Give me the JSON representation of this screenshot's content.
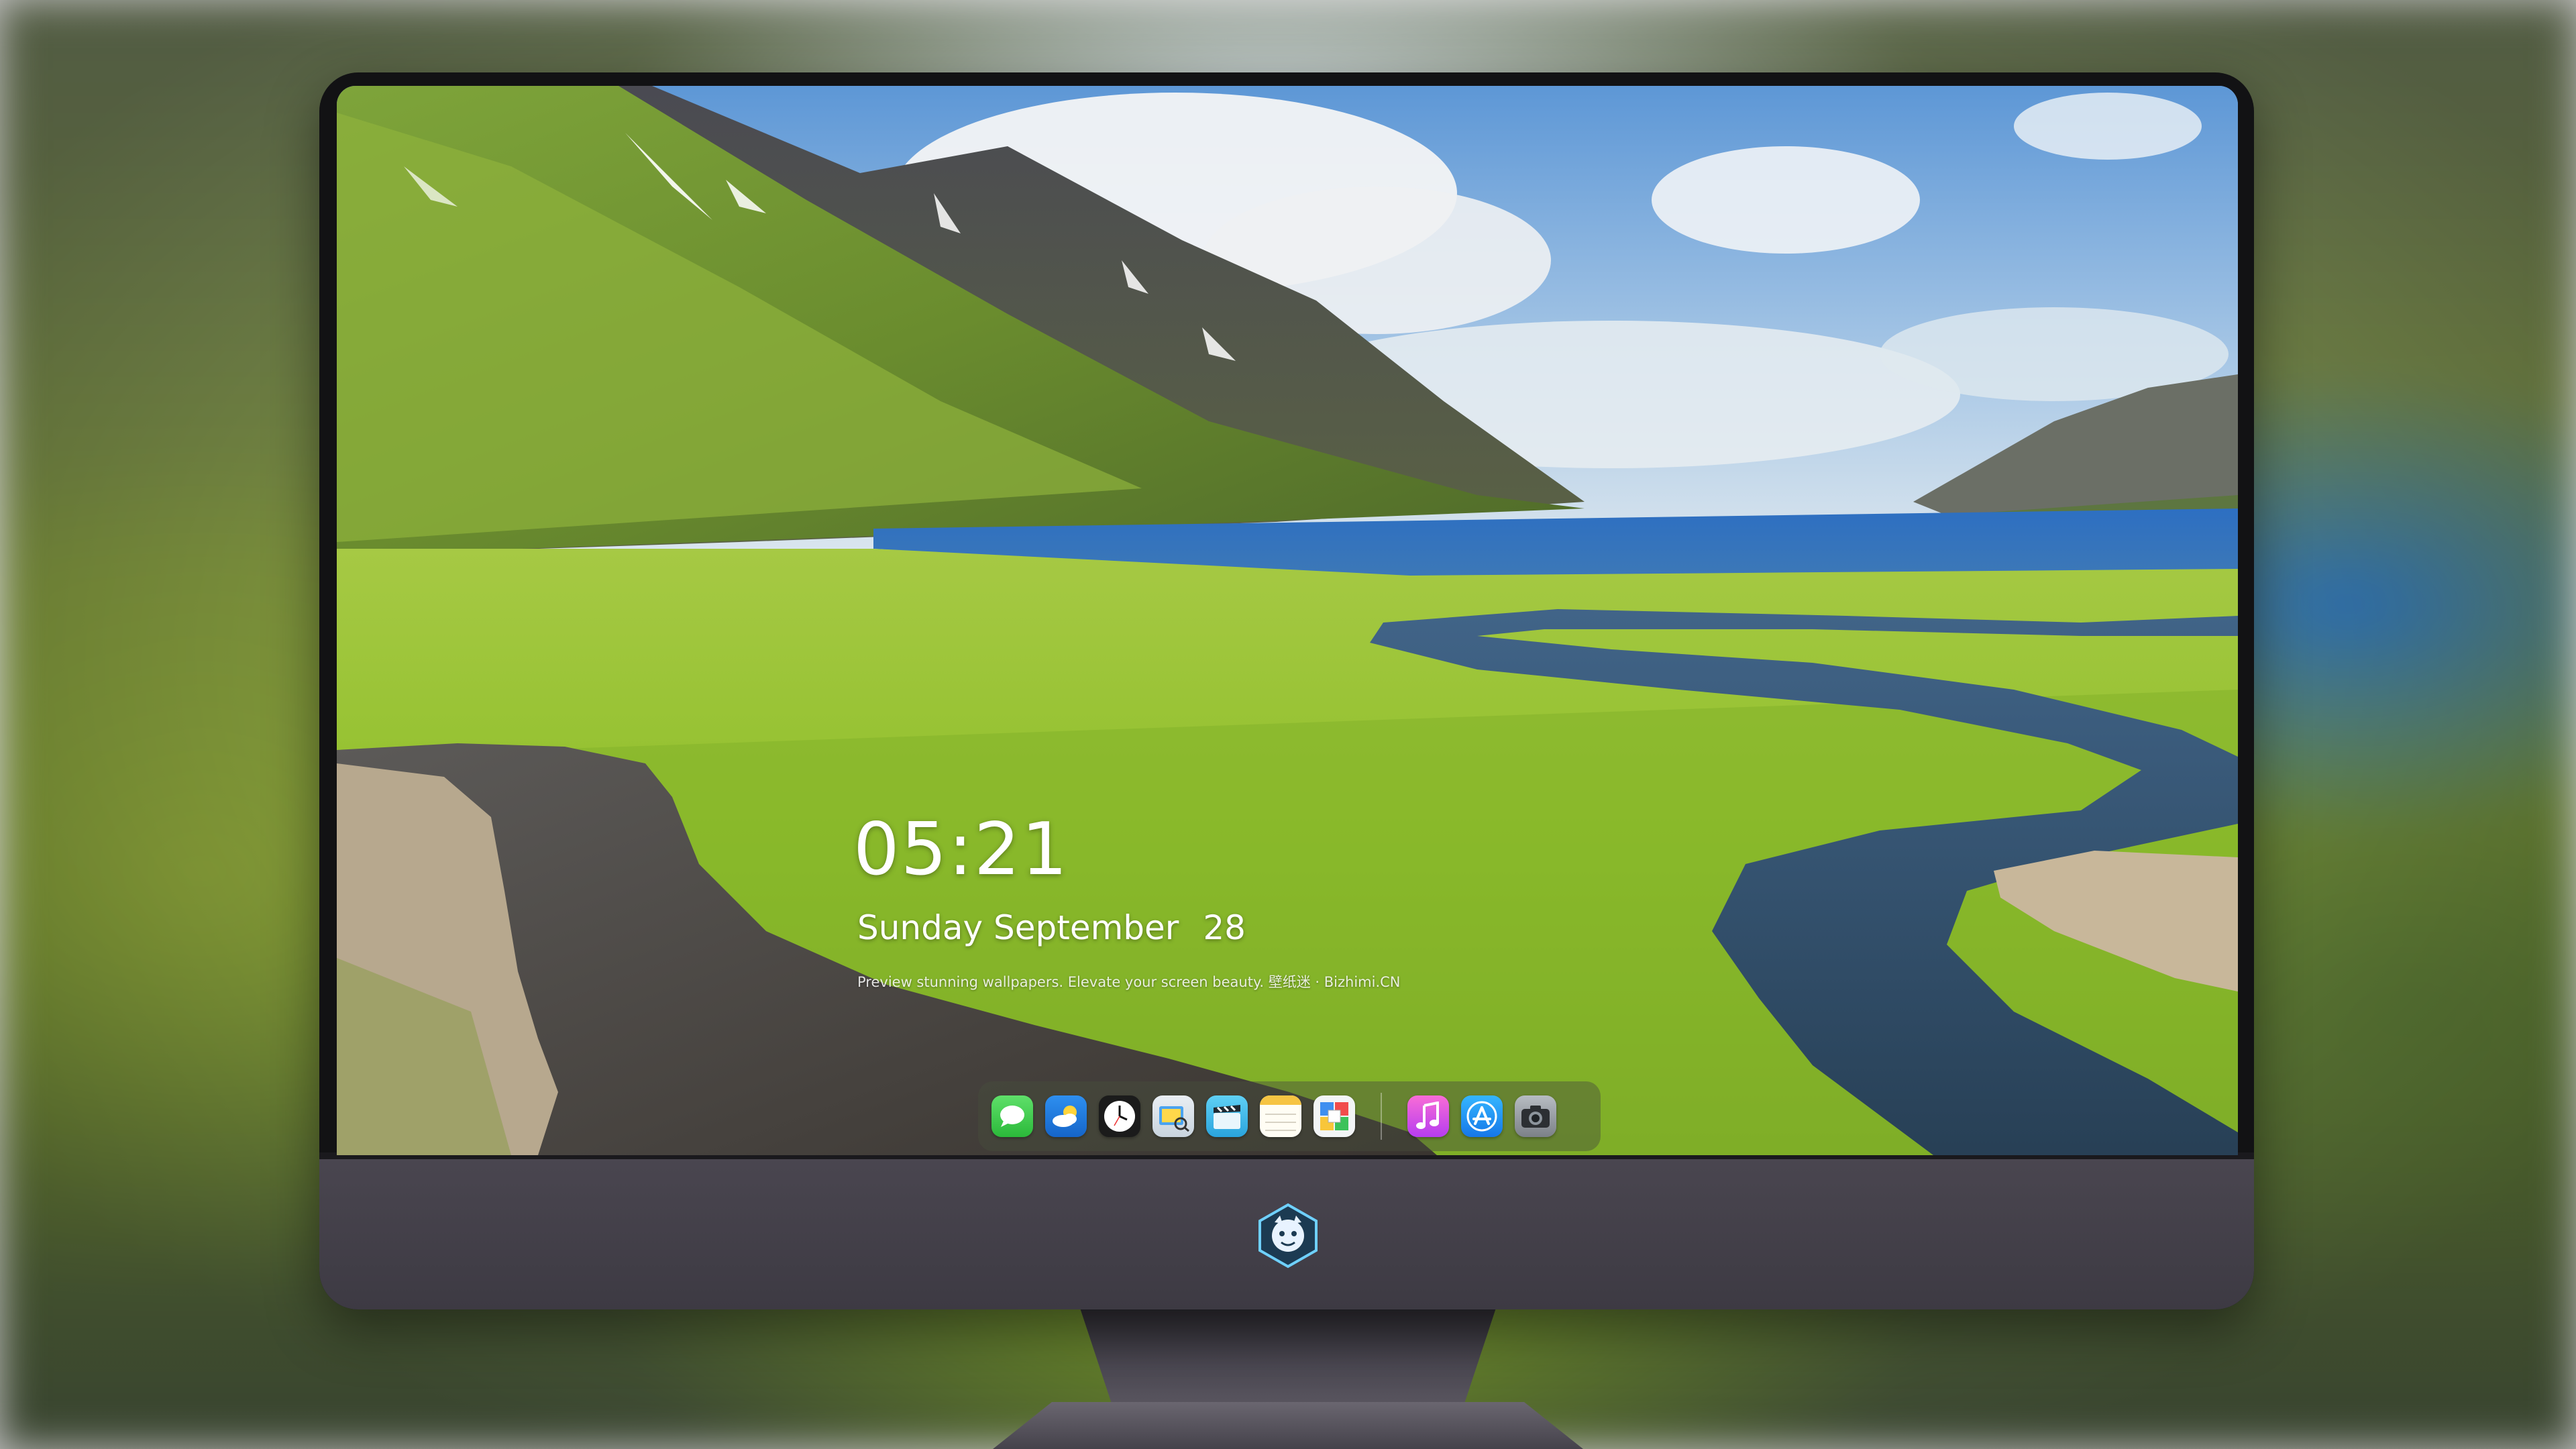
{
  "lockscreen": {
    "time": "05:21",
    "weekday_month": "Sunday September",
    "day": "28",
    "tagline": "Preview stunning wallpapers. Elevate your screen beauty. 壁纸迷 · Bizhimi.CN"
  },
  "dock": {
    "apps": [
      {
        "name": "messages-icon"
      },
      {
        "name": "weather-icon"
      },
      {
        "name": "clock-icon"
      },
      {
        "name": "preview-icon"
      },
      {
        "name": "video-clapper-icon"
      },
      {
        "name": "notes-icon"
      },
      {
        "name": "photo-collage-icon"
      },
      {
        "name": "music-icon"
      },
      {
        "name": "app-store-icon"
      },
      {
        "name": "camera-icon"
      }
    ]
  },
  "colors": {
    "sky": "#6aa0d8",
    "grass": "#8fbf2a",
    "lake": "#2f6fb8",
    "monitor_chin": "#403d46"
  }
}
